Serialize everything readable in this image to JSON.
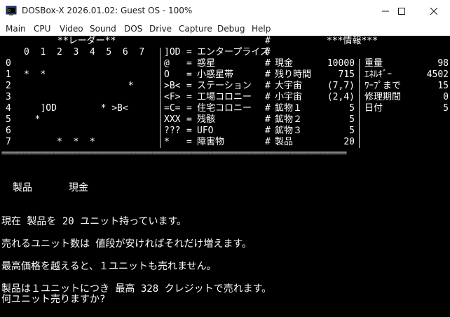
{
  "window": {
    "title": "DOSBox-X 2026.01.02: Guest OS - 100%",
    "icon": "dosbox-app-icon",
    "controls": [
      "minimize-icon",
      "maximize-icon",
      "close-icon"
    ]
  },
  "menu": [
    "Main",
    "CPU",
    "Video",
    "Sound",
    "DOS",
    "Drive",
    "Capture",
    "Debug",
    "Help"
  ],
  "radar": {
    "title": "**レーダー**",
    "columns_header": "0  1  2  3  4  5  6  7",
    "rows": [
      {
        "num": "0",
        "cells": ""
      },
      {
        "num": "1",
        "cells": "*  *"
      },
      {
        "num": "2",
        "cells": "                   *"
      },
      {
        "num": "3",
        "cells": ""
      },
      {
        "num": "4",
        "cells": "   ]OD        * >B<"
      },
      {
        "num": "5",
        "cells": "  *"
      },
      {
        "num": "6",
        "cells": ""
      },
      {
        "num": "7",
        "cells": "      *  *  *"
      }
    ]
  },
  "legend": [
    {
      "sym": "]OD",
      "label": "エンタープライズ"
    },
    {
      "sym": "@",
      "label": "惑星"
    },
    {
      "sym": "O",
      "label": "小惑星帯"
    },
    {
      "sym": ">B<",
      "label": "ステーション"
    },
    {
      "sym": "<F>",
      "label": "工場コロニー"
    },
    {
      "sym": "=C=",
      "label": "住宅コロニー"
    },
    {
      "sym": "XXX",
      "label": "残骸"
    },
    {
      "sym": "???",
      "label": "UFO"
    },
    {
      "sym": "*",
      "label": "障害物"
    }
  ],
  "info": {
    "title": "***情報***",
    "left": [
      {
        "label": "現金",
        "value": "10000"
      },
      {
        "label": "残り時間",
        "value": "715"
      },
      {
        "label": "大宇宙",
        "value": "(7,7)"
      },
      {
        "label": "小宇宙",
        "value": "(2,4)"
      },
      {
        "label": "鉱物１",
        "value": "5"
      },
      {
        "label": "鉱物２",
        "value": "5"
      },
      {
        "label": "鉱物３",
        "value": "5"
      },
      {
        "label": "製品",
        "value": "20"
      }
    ],
    "right": [
      {
        "label": "重量",
        "value": "98"
      },
      {
        "label": "ｴﾈﾙｷﾞｰ",
        "value": "4502"
      },
      {
        "label": "ﾜｰﾌﾟまで",
        "value": "15"
      },
      {
        "label": "修理期間",
        "value": "0"
      },
      {
        "label": "日付",
        "value": "5"
      }
    ]
  },
  "separator": "================================================================================",
  "trade": {
    "item": "製品",
    "currency": "現金",
    "lines": [
      "現在 製品を 20 ユニット持っています。",
      "売れるユニット数は 値段が安ければそれだけ増えます。",
      "最高価格を越えると、１ユニットも売れません。",
      "製品は１ユニットにつき 最高 328 クレジットで売れます。",
      "何ユニット売りますか?"
    ]
  }
}
